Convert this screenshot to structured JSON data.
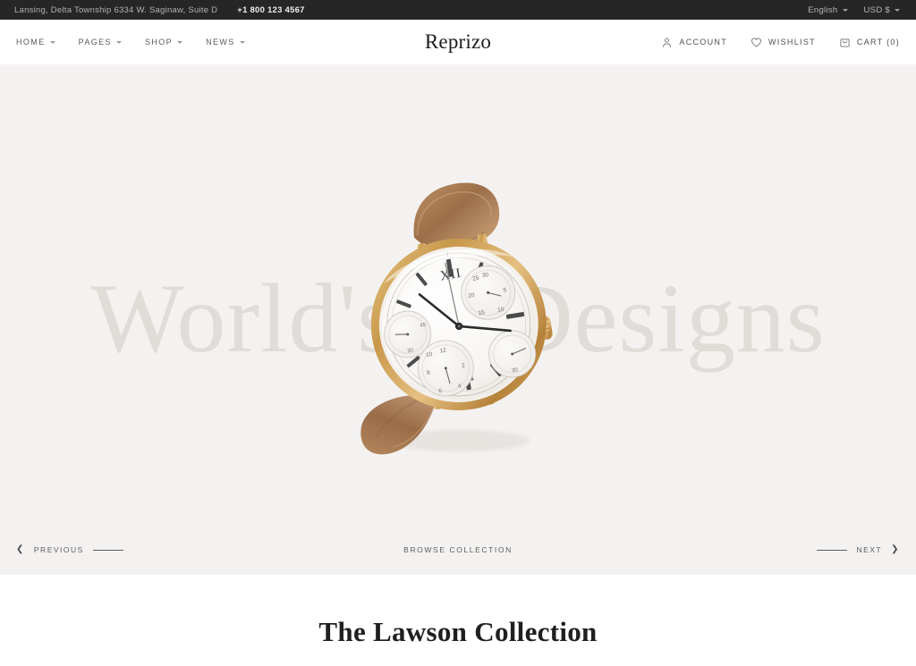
{
  "topbar": {
    "address": "Lansing, Delta Township 6334 W. Saginaw, Suite D",
    "phone": "+1 800 123 4567",
    "language": "English",
    "currency": "USD $"
  },
  "header": {
    "logo": "Reprizo",
    "nav": [
      {
        "label": "HOME",
        "icon": "chevron-down-icon"
      },
      {
        "label": "PAGES",
        "icon": "chevron-down-icon"
      },
      {
        "label": "SHOP",
        "icon": "chevron-down-icon"
      },
      {
        "label": "NEWS",
        "icon": "chevron-down-icon"
      }
    ],
    "account": "ACCOUNT",
    "wishlist": "WISHLIST",
    "cart": "CART (0)",
    "icons": {
      "account": "user-icon",
      "wishlist": "heart-icon",
      "cart": "shopping-bag-icon"
    }
  },
  "hero": {
    "bg_word_left": "World's",
    "bg_word_right": "Designs",
    "product_image": "gold-chronograph-watch-with-brown-leather-strap",
    "previous_label": "PREVIOUS",
    "next_label": "NEXT",
    "browse_label": "BROWSE COLLECTION",
    "prev_arrow": "chevron-left-icon",
    "next_arrow": "chevron-right-icon"
  },
  "collection": {
    "title": "The Lawson Collection"
  },
  "colors": {
    "topbar_bg": "#262626",
    "hero_bg": "#f4f2f1",
    "bg_text": "#e0dcd7",
    "body_bg": "#ffffff",
    "text_dark": "#1c1c1c",
    "text_muted": "#5d5d5d",
    "watch_gold": "#c99c4e",
    "watch_strap": "#a87a54"
  }
}
